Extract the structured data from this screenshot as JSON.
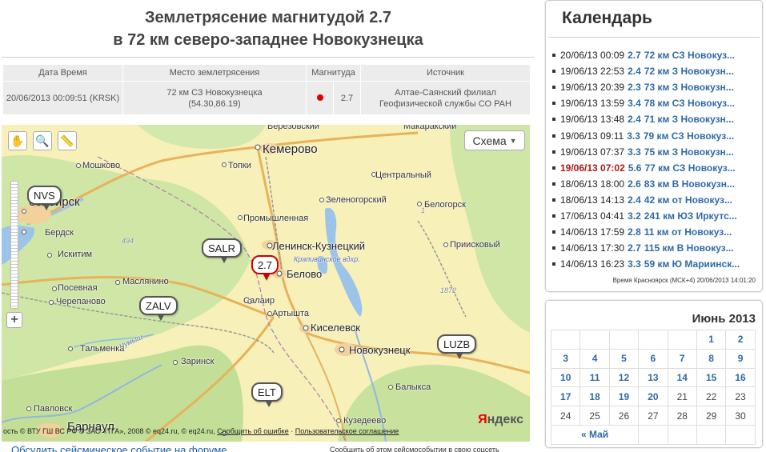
{
  "title": {
    "line1": "Землетрясение магнитудой 2.7",
    "line2": "в 72 км северо-западнее Новокузнецка"
  },
  "info_table": {
    "headers": [
      "Дата Время",
      "Место землетрясения",
      "Магнитуда",
      "Источник"
    ],
    "datetime": "20/06/2013 00:09:51 (KRSK)",
    "place_line1": "72 км СЗ Новокузнецка",
    "place_line2": "(54.30,86.19)",
    "magnitude": "2.7",
    "source_line1": "Алтае-Саянский филиал",
    "source_line2": "Геофизической службы СО РАН",
    "dot_color": "#e00000"
  },
  "map": {
    "scheme_label": "Схема",
    "tools": [
      "hand-icon",
      "zoom-box-icon",
      "ruler-icon"
    ],
    "quake_marker": "2.7",
    "stations": [
      "NVS",
      "SALR",
      "ZALV",
      "ELT",
      "LUZB"
    ],
    "cities": {
      "kemerovo": "Кемерово",
      "novosibirsk": "осибирск",
      "leninsk": "Ленинск-Кузнецкий",
      "belovo": "Белово",
      "kiselevsk": "Киселевск",
      "novokuznetsk": "Новокузнецк",
      "barnaul": "Барнаул"
    },
    "towns": {
      "makarakskiy": "Макаракский",
      "beryozovsky": "Берёзовский",
      "moshkovo": "Мошково",
      "topki": "Топки",
      "tsentralny": "Центральный",
      "zelenogorsky": "Зеленогорский",
      "belogorsk": "Белогорск",
      "berdsk": "Бердск",
      "promyshlennaya": "Промышленная",
      "iskitim": "Искитим",
      "prikovsky": "Приисковый",
      "maslyanino": "Маслянино",
      "posevnaya": "Посевная",
      "cherepanovo": "Черепаново",
      "salair": "Салаир",
      "artyshta": "Артышта",
      "talmenka": "Тальменка",
      "zarinsk": "Заринск",
      "pavlovsk": "Павловск",
      "kuzedeevo": "Кузедеево",
      "balyksa": "Балыкса"
    },
    "misc": {
      "reservoir": "Крапивинское вдхр.",
      "elev1": "494",
      "elev2": "1872",
      "elev3": "1",
      "river": "Чумыш"
    },
    "footer": {
      "copyright": "© ВТУ ГШ ВС РФ © ЗАО «ТГА», 2008  © eq24.ru, © eq24.ru,",
      "report_link": "Сообщить об ошибке",
      "terms_link": "Пользовательское соглашение",
      "prefix": "ость"
    },
    "logo": "Яндекс"
  },
  "bottom": {
    "link": "Обсудить сейсмическое событие на форуме",
    "note": "Сообщить об этом сейсмособытии в свою соцсеть"
  },
  "calendar": {
    "title": "Календарь",
    "events": [
      {
        "time": "20/06/13 00:09",
        "mag": "2.7",
        "text": "72 км СЗ Новокуз...",
        "highlight": false
      },
      {
        "time": "19/06/13 22:53",
        "mag": "2.4",
        "text": "72 км З Новокузн...",
        "highlight": false
      },
      {
        "time": "19/06/13 20:39",
        "mag": "2.3",
        "text": "73 км З Новокузн...",
        "highlight": false
      },
      {
        "time": "19/06/13 13:59",
        "mag": "3.4",
        "text": "78 км СЗ Новокуз...",
        "highlight": false
      },
      {
        "time": "19/06/13 13:48",
        "mag": "2.4",
        "text": "71 км З Новокузн...",
        "highlight": false
      },
      {
        "time": "19/06/13 09:11",
        "mag": "3.3",
        "text": "79 км СЗ Новокуз...",
        "highlight": false
      },
      {
        "time": "19/06/13 07:37",
        "mag": "3.3",
        "text": "75 км З Новокузн...",
        "highlight": false
      },
      {
        "time": "19/06/13 07:02",
        "mag": "5.6",
        "text": "77 км СЗ Новокуз...",
        "highlight": true
      },
      {
        "time": "18/06/13 18:00",
        "mag": "2.6",
        "text": "83 км В Новокузн...",
        "highlight": false
      },
      {
        "time": "18/06/13 14:13",
        "mag": "2.4",
        "text": "42 км от Новокуз...",
        "highlight": false
      },
      {
        "time": "17/06/13 04:41",
        "mag": "3.2",
        "text": "241 км ЮЗ Иркутс...",
        "highlight": false
      },
      {
        "time": "14/06/13 17:59",
        "mag": "2.8",
        "text": "11 км от Новокуз...",
        "highlight": false
      },
      {
        "time": "14/06/13 17:30",
        "mag": "2.7",
        "text": "115 км В Новокуз...",
        "highlight": false
      },
      {
        "time": "14/06/13 16:23",
        "mag": "3.3",
        "text": "59 км Ю Мариинск...",
        "highlight": false
      }
    ],
    "tz_note": "Время Красноярск (МСК+4) 20/06/2013 14:01:20"
  },
  "month": {
    "title": "Июнь 2013",
    "weeks": [
      [
        "",
        "",
        "",
        "",
        "",
        "1",
        "2"
      ],
      [
        "3",
        "4",
        "5",
        "6",
        "7",
        "8",
        "9"
      ],
      [
        "10",
        "11",
        "12",
        "13",
        "14",
        "15",
        "16"
      ],
      [
        "17",
        "18",
        "19",
        "20",
        "21",
        "22",
        "23"
      ],
      [
        "24",
        "25",
        "26",
        "27",
        "28",
        "29",
        "30"
      ]
    ],
    "linked_until": 20,
    "prev_link": "« Май"
  }
}
